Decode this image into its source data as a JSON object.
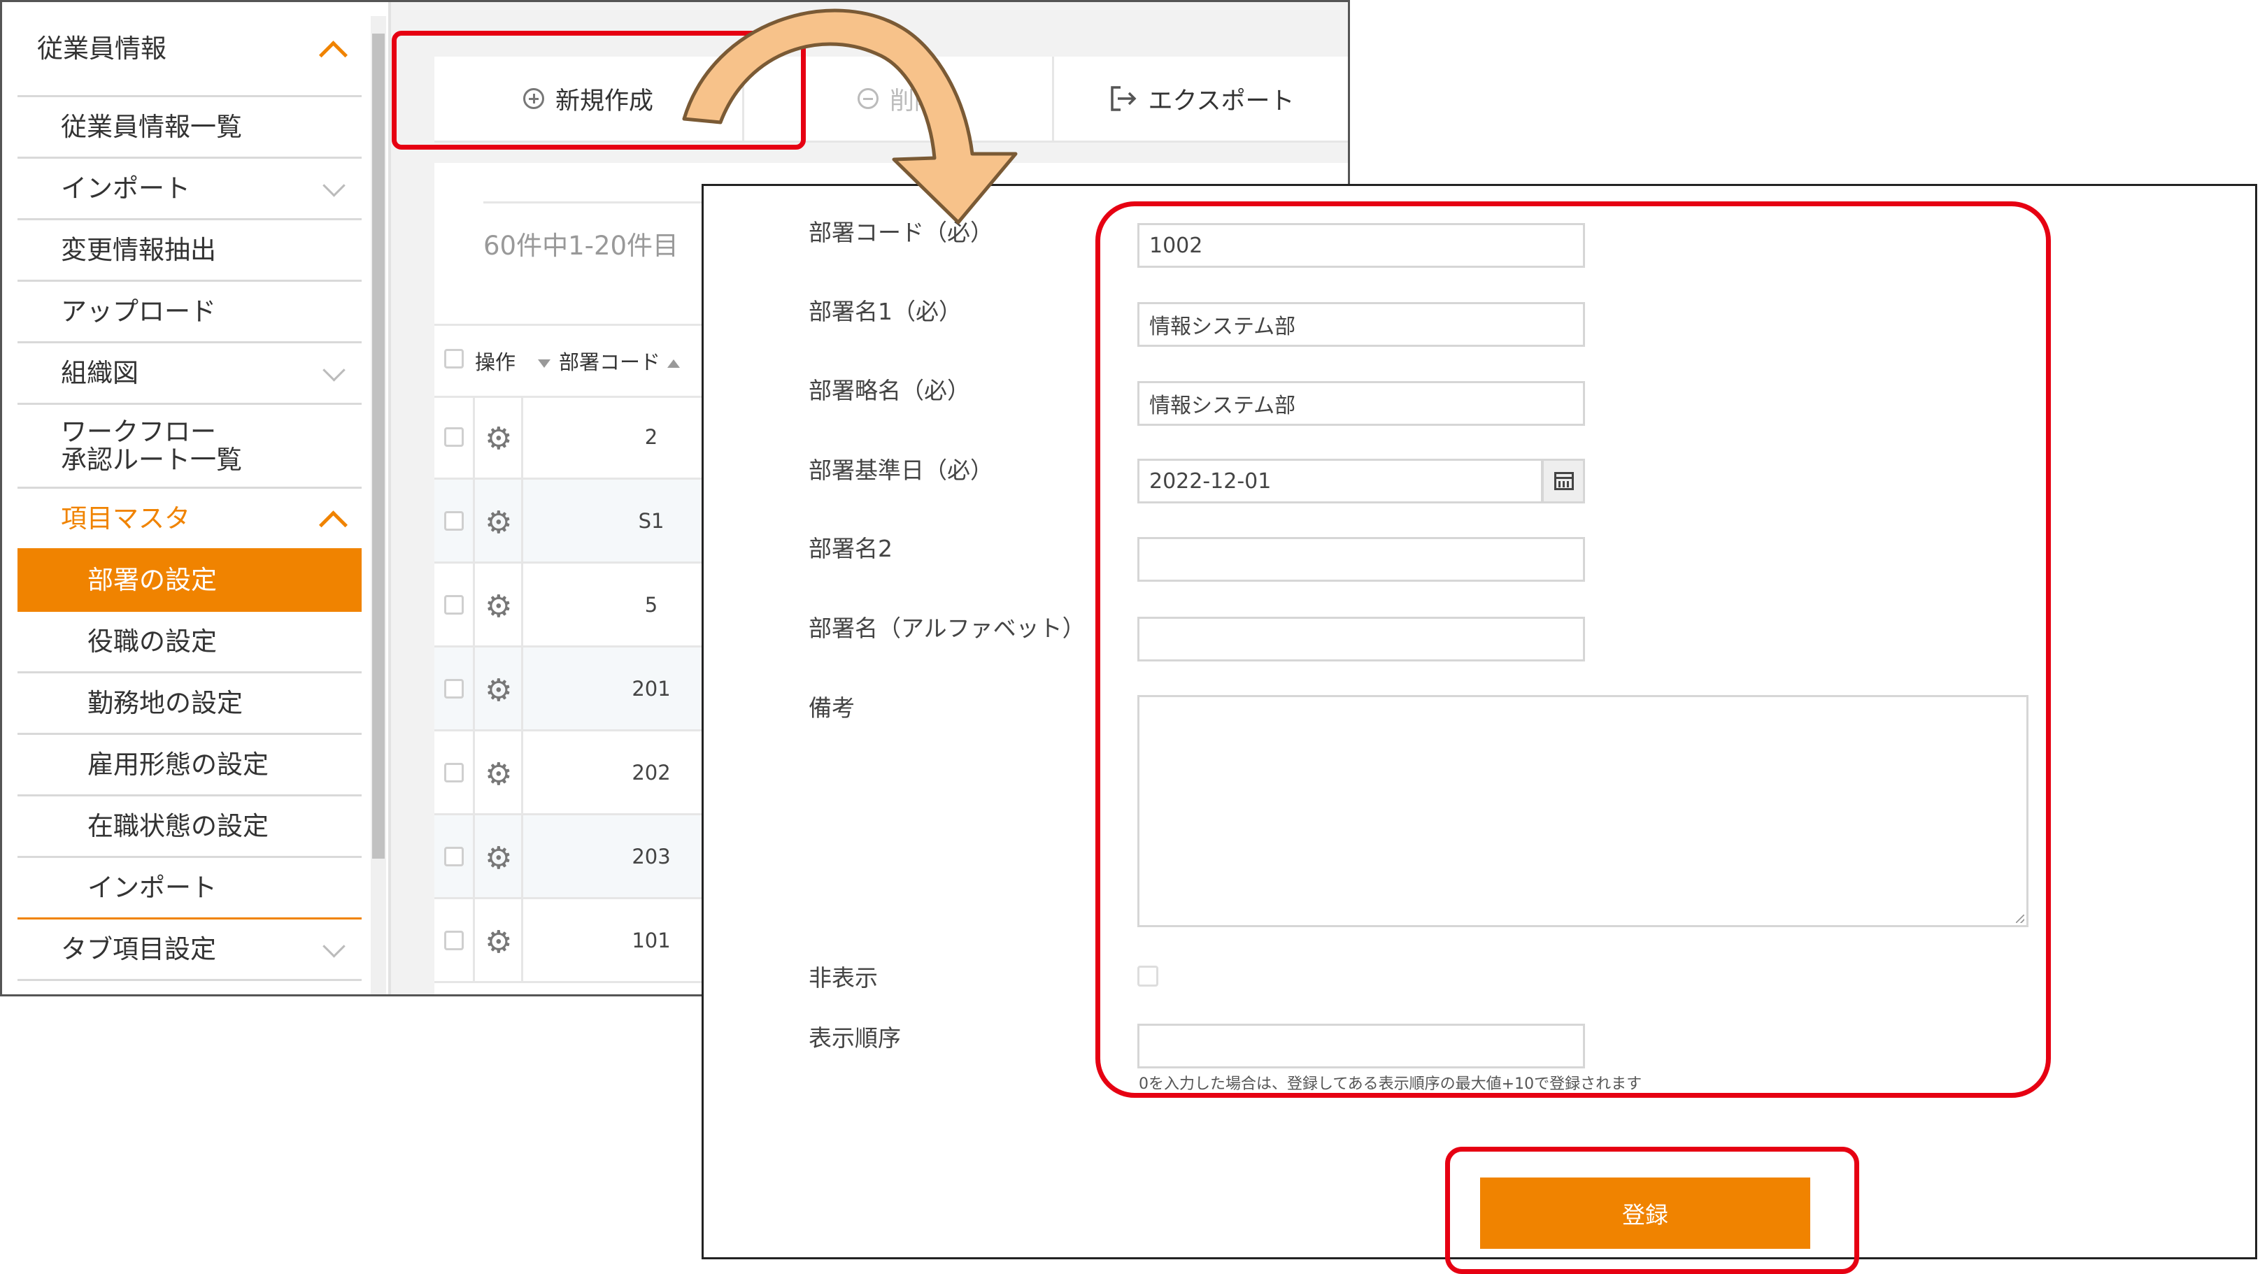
{
  "sidebar": {
    "items": [
      {
        "label": "従業員情報"
      },
      {
        "label": "従業員情報一覧"
      },
      {
        "label": "インポート"
      },
      {
        "label": "変更情報抽出"
      },
      {
        "label": "アップロード"
      },
      {
        "label": "組織図"
      },
      {
        "label_line1": "ワークフロー",
        "label_line2": "承認ルート一覧"
      },
      {
        "label": "項目マスタ"
      },
      {
        "label": "部署の設定"
      },
      {
        "label": "役職の設定"
      },
      {
        "label": "勤務地の設定"
      },
      {
        "label": "雇用形態の設定"
      },
      {
        "label": "在職状態の設定"
      },
      {
        "label": "インポート"
      },
      {
        "label": "タブ項目設定"
      }
    ]
  },
  "toolbar": {
    "new_label": "新規作成",
    "delete_label": "削除",
    "export_label": "エクスポート"
  },
  "list": {
    "count_text": "60件中1-20件目",
    "header_ops": "操作",
    "header_code": "部署コード",
    "rows": [
      {
        "code": "2"
      },
      {
        "code": "S1"
      },
      {
        "code": "5"
      },
      {
        "code": "201"
      },
      {
        "code": "202"
      },
      {
        "code": "203"
      },
      {
        "code": "101"
      }
    ]
  },
  "form": {
    "dept_code_label": "部署コード（必）",
    "dept_code_value": "1002",
    "dept_name1_label": "部署名1（必）",
    "dept_name1_value": "情報システム部",
    "dept_short_label": "部署略名（必）",
    "dept_short_value": "情報システム部",
    "base_date_label": "部署基準日（必）",
    "base_date_value": "2022-12-01",
    "dept_name2_label": "部署名2",
    "dept_name2_value": "",
    "dept_alpha_label": "部署名（アルファベット）",
    "dept_alpha_value": "",
    "remarks_label": "備考",
    "remarks_value": "",
    "hidden_label": "非表示",
    "hidden_checked": false,
    "order_label": "表示順序",
    "order_value": "",
    "order_note": "0を入力した場合は、登録してある表示順序の最大値+10で登録されます",
    "register_label": "登録"
  },
  "colors": {
    "accent": "#f08300",
    "annotation_red": "#e60012",
    "arrow_fill": "#f7c28a"
  },
  "icons": {
    "new": "plus-circle-icon",
    "delete": "minus-circle-icon",
    "export": "export-icon",
    "row_action": "gear-icon",
    "date_picker": "calendar-icon"
  }
}
